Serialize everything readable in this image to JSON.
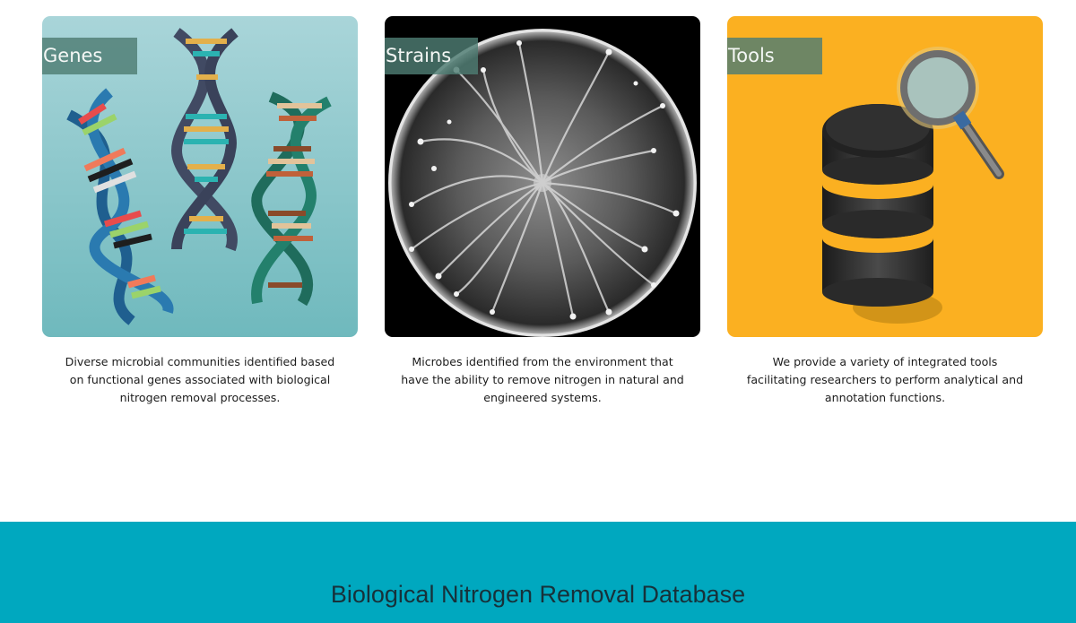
{
  "cards": [
    {
      "label": "Genes",
      "description": "Diverse microbial communities identified based on functional genes associated with biological nitrogen removal processes.",
      "image": "dna-helix-illustration",
      "background": "#8fc9cc"
    },
    {
      "label": "Strains",
      "description": "Microbes identified from the environment that have the ability to remove nitrogen in natural and engineered systems.",
      "image": "petri-dish-colony-photo",
      "background": "#000000"
    },
    {
      "label": "Tools",
      "description": "We provide a variety of integrated tools facilitating researchers to perform analytical and annotation functions.",
      "image": "database-magnifier-illustration",
      "background": "#fbb021"
    }
  ],
  "footer": {
    "title": "Biological Nitrogen Removal Database",
    "background": "#00a8bf"
  }
}
